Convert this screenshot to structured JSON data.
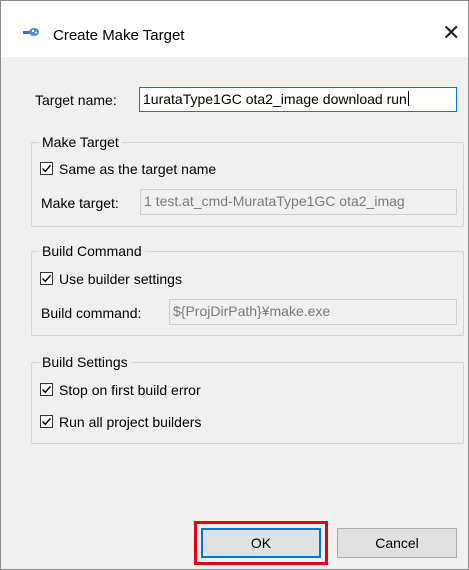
{
  "window": {
    "title": "Create Make Target",
    "close_glyph": "✕"
  },
  "target_name": {
    "label": "Target name:",
    "value": "1urataType1GC ota2_image download run"
  },
  "make_target_group": {
    "title": "Make Target",
    "same_as_name": {
      "label": "Same as the target name",
      "checked": true
    },
    "make_target_label": "Make target:",
    "make_target_value": "1 test.at_cmd-MurataType1GC ota2_imag"
  },
  "build_command_group": {
    "title": "Build Command",
    "use_builder": {
      "label": "Use builder settings",
      "checked": true
    },
    "build_command_label": "Build command:",
    "build_command_value": "${ProjDirPath}¥make.exe"
  },
  "build_settings_group": {
    "title": "Build Settings",
    "stop_on_error": {
      "label": "Stop on first build error",
      "checked": true
    },
    "run_all_builders": {
      "label": "Run all project builders",
      "checked": true
    }
  },
  "buttons": {
    "ok": "OK",
    "cancel": "Cancel"
  },
  "colors": {
    "highlight": "#e60012",
    "focus": "#0078d7"
  }
}
